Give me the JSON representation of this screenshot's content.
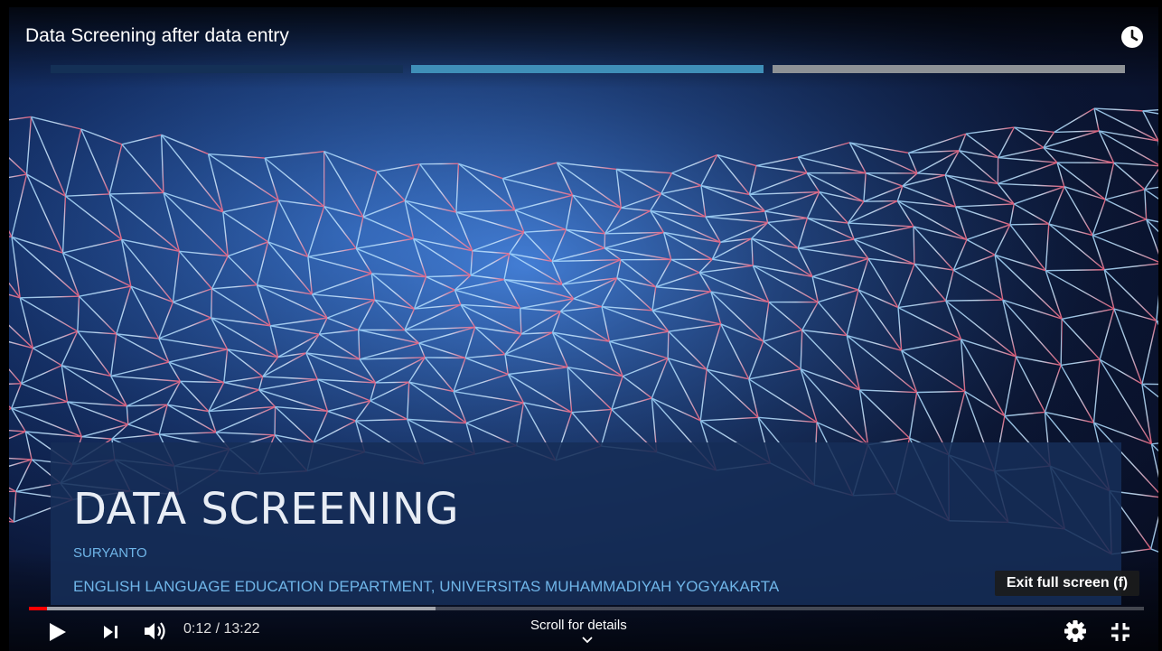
{
  "player": {
    "title": "Data Screening after data entry",
    "tooltip": "Exit full screen (f)",
    "time": "0:12 / 13:22",
    "scroll_hint": "Scroll for details",
    "played_fraction": 0.016,
    "buffered_fraction": 0.365,
    "colors": {
      "played": "#ff0000",
      "accent": "#3f8fb8"
    }
  },
  "chapters": [
    {
      "state": "done"
    },
    {
      "state": "current"
    },
    {
      "state": "upcoming"
    }
  ],
  "slide": {
    "title": "DATA SCREENING",
    "author": "SURYANTO",
    "affiliation": "ENGLISH LANGUAGE EDUCATION DEPARTMENT, UNIVERSITAS MUHAMMADIYAH YOGYAKARTA"
  },
  "controls": {
    "play_icon": "play-icon",
    "next_icon": "next-icon",
    "volume_icon": "volume-icon",
    "settings_icon": "gear-icon",
    "exit_fullscreen_icon": "exit-fullscreen-icon"
  }
}
